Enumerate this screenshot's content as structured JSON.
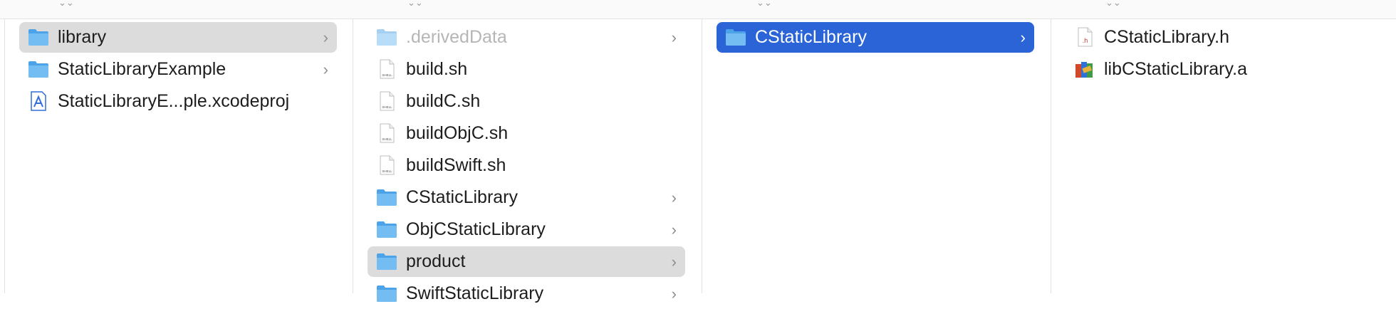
{
  "header": {
    "stub_glyph": "⌄⌄"
  },
  "columns": [
    {
      "name": "root",
      "items": [
        {
          "label": "library",
          "icon": "folder-icon",
          "has_children": true,
          "selected": "gray"
        },
        {
          "label": "StaticLibraryExample",
          "icon": "folder-icon",
          "has_children": true
        },
        {
          "label": "StaticLibraryE...ple.xcodeproj",
          "icon": "xcodeproj-icon",
          "has_children": false
        }
      ]
    },
    {
      "name": "library",
      "items": [
        {
          "label": ".derivedData",
          "icon": "folder-icon",
          "has_children": true,
          "dimmed": true
        },
        {
          "label": "build.sh",
          "icon": "shell-script-icon",
          "has_children": false
        },
        {
          "label": "buildC.sh",
          "icon": "shell-script-icon",
          "has_children": false
        },
        {
          "label": "buildObjC.sh",
          "icon": "shell-script-icon",
          "has_children": false
        },
        {
          "label": "buildSwift.sh",
          "icon": "shell-script-icon",
          "has_children": false
        },
        {
          "label": "CStaticLibrary",
          "icon": "folder-icon",
          "has_children": true
        },
        {
          "label": "ObjCStaticLibrary",
          "icon": "folder-icon",
          "has_children": true
        },
        {
          "label": "product",
          "icon": "folder-icon",
          "has_children": true,
          "selected": "gray"
        },
        {
          "label": "SwiftStaticLibrary",
          "icon": "folder-icon",
          "has_children": true
        }
      ]
    },
    {
      "name": "product",
      "items": [
        {
          "label": "CStaticLibrary",
          "icon": "folder-icon",
          "has_children": true,
          "selected": "blue"
        }
      ]
    },
    {
      "name": "CStaticLibrary",
      "items": [
        {
          "label": "CStaticLibrary.h",
          "icon": "header-file-icon",
          "has_children": false
        },
        {
          "label": "libCStaticLibrary.a",
          "icon": "static-library-icon",
          "has_children": false
        }
      ]
    }
  ],
  "chevron": "›",
  "colors": {
    "selection_blue": "#2a64d7",
    "selection_gray": "#dcdcdc",
    "folder_blue": "#5fb0ec"
  }
}
